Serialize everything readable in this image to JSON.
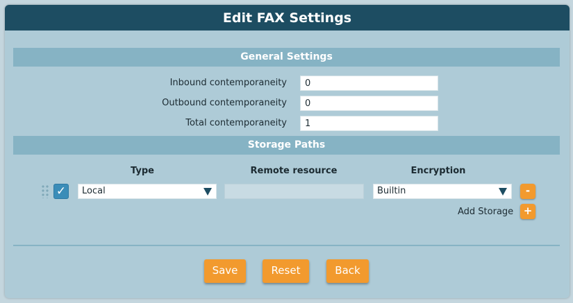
{
  "dialog": {
    "title": "Edit FAX Settings"
  },
  "general": {
    "header": "General Settings",
    "fields": [
      {
        "label": "Inbound contemporaneity",
        "value": "0"
      },
      {
        "label": "Outbound contemporaneity",
        "value": "0"
      },
      {
        "label": "Total contemporaneity",
        "value": "1"
      }
    ]
  },
  "storage": {
    "header": "Storage Paths",
    "columns": {
      "type": "Type",
      "remote": "Remote resource",
      "encryption": "Encryption"
    },
    "rows": [
      {
        "enabled": true,
        "type": "Local",
        "remote": "",
        "encryption": "Builtin"
      }
    ],
    "checkbox_glyph": "✓",
    "remove_glyph": "-",
    "add_label": "Add Storage",
    "add_glyph": "+"
  },
  "actions": {
    "save": "Save",
    "reset": "Reset",
    "back": "Back"
  },
  "colors": {
    "titlebar": "#1d4d62",
    "section_bar": "#86b3c4",
    "panel": "#aecbd7",
    "accent_button": "#f29a2e",
    "checkbox": "#3b8db8"
  },
  "icons": {
    "drag": "drag-handle-icon",
    "check": "checkmark-icon",
    "dropdown": "dropdown-arrow-icon",
    "remove": "minus-icon",
    "add": "plus-icon"
  }
}
